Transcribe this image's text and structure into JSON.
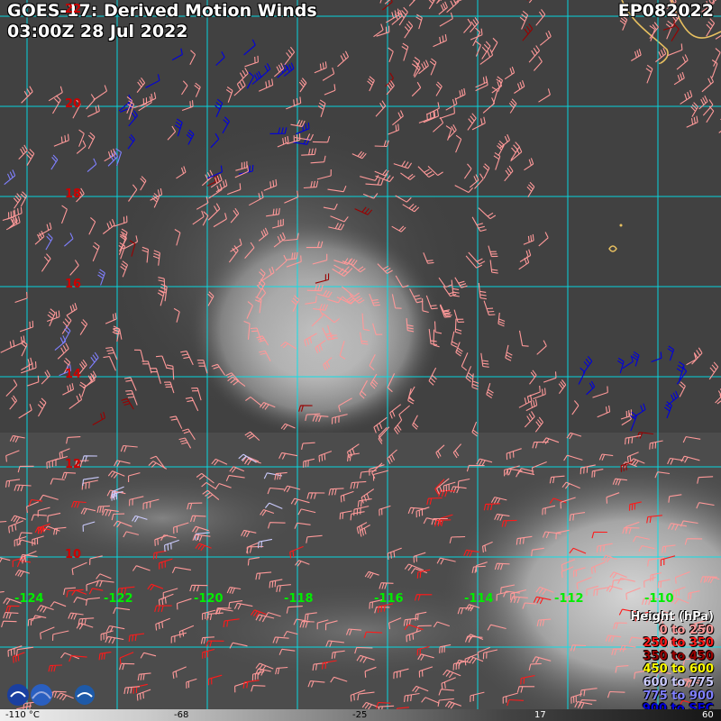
{
  "header": {
    "title": "GOES-17: Derived Motion Winds",
    "datetime": "03:00Z 28 Jul 2022",
    "storm_id": "EP082022"
  },
  "map": {
    "lat_labels": [
      "22",
      "20",
      "18",
      "16",
      "14",
      "12",
      "10"
    ],
    "lon_labels": [
      "-124",
      "-122",
      "-120",
      "-118",
      "-116",
      "-114",
      "-112",
      "-110"
    ],
    "lat_color": "#cc0000",
    "lon_color": "#00ee00",
    "grid_color": "#00e5ee",
    "coastline_color": "#e8c060"
  },
  "legend": {
    "title": "Height (hPa)",
    "items": [
      {
        "label": "0 to 250",
        "color": "#ff9999"
      },
      {
        "label": "250 to 350",
        "color": "#ff1a1a"
      },
      {
        "label": "350 to 450",
        "color": "#990000"
      },
      {
        "label": "450 to 600",
        "color": "#ffff00"
      },
      {
        "label": "600 to 775",
        "color": "#ccccff"
      },
      {
        "label": "775 to 900",
        "color": "#8080ff"
      },
      {
        "label": "900 to SFC",
        "color": "#0000dd"
      }
    ]
  },
  "colorbar": {
    "ticks": [
      "-110 °C",
      "-68",
      "-25",
      "17",
      "60"
    ]
  }
}
